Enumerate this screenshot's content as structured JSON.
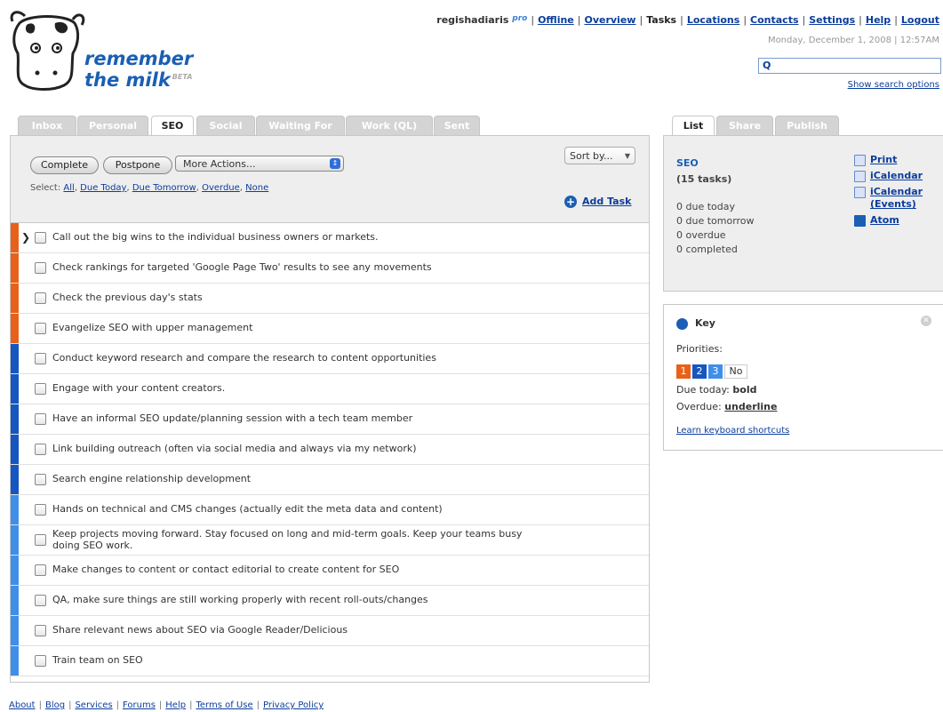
{
  "brand": {
    "line1": "remember",
    "line2": "the milk",
    "beta": "BETA"
  },
  "topnav": {
    "user": "regishadiaris",
    "pro": "pro",
    "links": [
      "Offline",
      "Overview"
    ],
    "current": "Tasks",
    "links2": [
      "Locations",
      "Contacts",
      "Settings",
      "Help",
      "Logout"
    ]
  },
  "datetime": "Monday, December 1, 2008 | 12:57AM",
  "search": {
    "icon": "search-icon",
    "value": "",
    "show_options": "Show search options"
  },
  "list_tabs": [
    {
      "label": "Inbox"
    },
    {
      "label": "Personal"
    },
    {
      "label": "SEO"
    },
    {
      "label": "Social"
    },
    {
      "label": "Waiting For"
    },
    {
      "label": "Work (QL)"
    },
    {
      "label": "Sent"
    }
  ],
  "toolbar": {
    "complete": "Complete",
    "postpone": "Postpone",
    "more_actions": "More Actions...",
    "select_label": "Select:",
    "select_links": [
      "All",
      "Due Today",
      "Due Tomorrow",
      "Overdue",
      "None"
    ],
    "sort_by": "Sort by...",
    "add_task": "Add Task"
  },
  "colors": {
    "p1": "#e8611a",
    "p2": "#1656c0",
    "p3": "#3f8fe8",
    "link": "#0b3d9c"
  },
  "tasks": [
    {
      "text": "Call out the big wins to the individual business owners or markets.",
      "priority": 1
    },
    {
      "text": "Check rankings for targeted 'Google Page Two' results to see any movements",
      "priority": 1
    },
    {
      "text": "Check the previous day's stats",
      "priority": 1
    },
    {
      "text": "Evangelize SEO with upper management",
      "priority": 1
    },
    {
      "text": "Conduct keyword research and compare the research to content opportunities",
      "priority": 2
    },
    {
      "text": "Engage with your content creators.",
      "priority": 2
    },
    {
      "text": "Have an informal SEO update/planning session with a tech team member",
      "priority": 2
    },
    {
      "text": "Link building outreach (often via social media and always via my network)",
      "priority": 2
    },
    {
      "text": "Search engine relationship development",
      "priority": 2
    },
    {
      "text": "Hands on technical and CMS changes (actually edit the meta data and content)",
      "priority": 3
    },
    {
      "text": "Keep projects moving forward. Stay focused on long and mid-term goals. Keep your teams busy doing SEO work.",
      "priority": 3
    },
    {
      "text": "Make changes to content or contact editorial to create content for SEO",
      "priority": 3
    },
    {
      "text": "QA, make sure things are still working properly with recent roll-outs/changes",
      "priority": 3
    },
    {
      "text": "Share relevant news about SEO via Google Reader/Delicious",
      "priority": 3
    },
    {
      "text": "Train team on SEO",
      "priority": 3
    }
  ],
  "right_tabs": [
    {
      "label": "List"
    },
    {
      "label": "Share"
    },
    {
      "label": "Publish"
    }
  ],
  "list_info": {
    "name": "SEO",
    "count": "(15 tasks)",
    "stats": [
      "0 due today",
      "0 due tomorrow",
      "0 overdue",
      "0 completed"
    ],
    "links": [
      {
        "label": "Print",
        "icon": "print-icon"
      },
      {
        "label": "iCalendar",
        "icon": "calendar-icon"
      },
      {
        "label": "iCalendar (Events)",
        "icon": "calendar-icon"
      },
      {
        "label": "Atom",
        "icon": "rss-icon"
      }
    ]
  },
  "key": {
    "title": "Key",
    "priorities_label": "Priorities:",
    "priorities": [
      "1",
      "2",
      "3",
      "No"
    ],
    "due_today_label": "Due today:",
    "due_today_value": "bold",
    "overdue_label": "Overdue:",
    "overdue_value": "underline",
    "shortcuts": "Learn keyboard shortcuts"
  },
  "footer": [
    "About",
    "Blog",
    "Services",
    "Forums",
    "Help",
    "Terms of Use",
    "Privacy Policy"
  ]
}
